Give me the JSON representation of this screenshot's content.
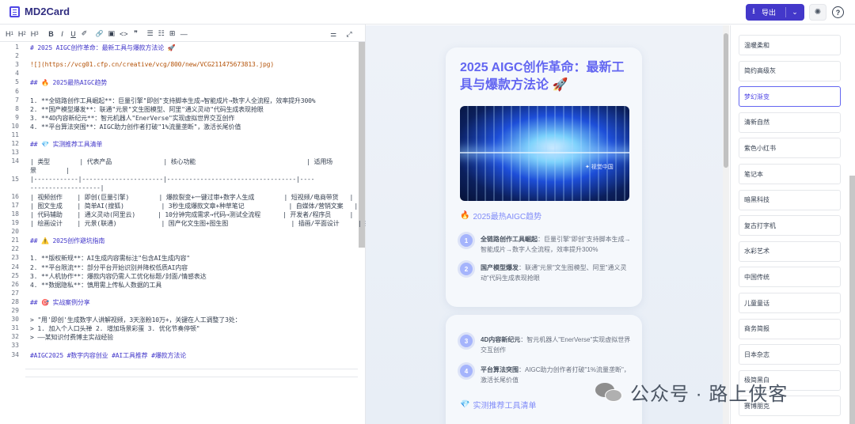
{
  "app": {
    "title": "MD2Card"
  },
  "header": {
    "export_label": "导出",
    "download_icon": "⭳",
    "chevron_icon": "⌄",
    "theme_icon": "✺",
    "help_icon": "?"
  },
  "toolbar": {
    "h1": "H",
    "h2": "H",
    "h3": "H",
    "s1": "1",
    "s2": "2",
    "s3": "3",
    "bold": "B",
    "italic": "I",
    "underline": "U",
    "strike": "✐",
    "link": "🔗",
    "image": "▣",
    "code": "<>",
    "quote": "❞",
    "ul": "☰",
    "ol": "☷",
    "table": "⊞",
    "hr": "—",
    "right1": "⚌",
    "right2": "⤢"
  },
  "editor": {
    "lines": [
      {
        "n": "1",
        "t": "# 2025 AIGC创作革命：最新工具与爆款方法论 🚀",
        "k": "hd"
      },
      {
        "n": "2",
        "t": "",
        "k": ""
      },
      {
        "n": "3",
        "t": "![](https://vcg01.cfp.cn/creative/vcg/800/new/VCG211475673813.jpg)",
        "k": "lnk"
      },
      {
        "n": "4",
        "t": "",
        "k": ""
      },
      {
        "n": "5",
        "t": "## 🔥 2025最热AIGC趋势",
        "k": "hd"
      },
      {
        "n": "6",
        "t": "",
        "k": ""
      },
      {
        "n": "7",
        "t": "1. **全链路创作工具崛起**：巨量引擎\"即创\"支持脚本生成→智能成片→数字人全流程，效率提升300%",
        "k": ""
      },
      {
        "n": "8",
        "t": "2. **国产模型爆发**：联通\"元景\"文生图模型、阿里\"通义灵动\"代码生成表现抢眼",
        "k": ""
      },
      {
        "n": "9",
        "t": "3. **4D内容新纪元**：智元机器人\"EnerVerse\"实现虚拟世界交互创作",
        "k": ""
      },
      {
        "n": "10",
        "t": "4. **平台算法突围**：AIGC助力创作者打破\"1%流量垄断\"，激活长尾价值",
        "k": ""
      },
      {
        "n": "11",
        "t": "",
        "k": ""
      },
      {
        "n": "12",
        "t": "## 💎 实测推荐工具清单",
        "k": "hd"
      },
      {
        "n": "13",
        "t": "",
        "k": ""
      },
      {
        "n": "14",
        "t": "| 类型        | 代表产品              | 核心功能                              | 适用场",
        "k": "tbl"
      },
      {
        "n": "",
        "t": "景        |",
        "k": "tbl"
      },
      {
        "n": "15",
        "t": "|------------|----------------------|-----------------------------------|----",
        "k": "tbl"
      },
      {
        "n": "",
        "t": "-------------------|",
        "k": "tbl"
      },
      {
        "n": "16",
        "t": "| 视频创作    | 即创(巨量引擎)        | 爆款裂变+一键过审+数字人生成        | 短视频/电商带货   |",
        "k": "tbl"
      },
      {
        "n": "17",
        "t": "| 图文生成    | 简单AI(搜狐)          | 3秒生成爆款文章+种草笔记            | 自媒体/营销文案   |",
        "k": "tbl"
      },
      {
        "n": "18",
        "t": "| 代码辅助    | 通义灵动(阿里云)      | 10分钟完成需求→代码→测试全流程      | 开发者/程序员     |",
        "k": "tbl"
      },
      {
        "n": "19",
        "t": "| 绘画设计    | 元景(联通)            | 国产化文生图+图生图                 | 插画/平面设计     |",
        "k": "tbl"
      },
      {
        "n": "20",
        "t": "",
        "k": ""
      },
      {
        "n": "21",
        "t": "## ⚠️ 2025创作避坑指南",
        "k": "hd"
      },
      {
        "n": "22",
        "t": "",
        "k": ""
      },
      {
        "n": "23",
        "t": "1. **版权新规**：AI生成内容需标注\"包含AI生成内容\"",
        "k": ""
      },
      {
        "n": "24",
        "t": "2. **平台限流**：部分平台开始识别并降权低质AI内容",
        "k": ""
      },
      {
        "n": "25",
        "t": "3. **人机协作**：爆款内容仍需人工优化标题/封面/情感表达",
        "k": ""
      },
      {
        "n": "26",
        "t": "4. **数据隐私**：慎用需上传私人数据的工具",
        "k": ""
      },
      {
        "n": "27",
        "t": "",
        "k": ""
      },
      {
        "n": "28",
        "t": "## 🎯 实战案例分享",
        "k": "hd"
      },
      {
        "n": "29",
        "t": "",
        "k": ""
      },
      {
        "n": "30",
        "t": "> \"用'即创'生成数字人讲解视频，3天涨粉10万+，关键在人工调整了3处：",
        "k": ""
      },
      {
        "n": "31",
        "t": "> 1. 加入个人口头禅 2. 增加场景彩蛋 3. 优化节奏停顿\"",
        "k": ""
      },
      {
        "n": "32",
        "t": "> ——某知识付费博主实战经验",
        "k": ""
      },
      {
        "n": "33",
        "t": "",
        "k": ""
      },
      {
        "n": "34",
        "t": "#AIGC2025 #数字内容创业 #AI工具推荐 #爆款方法论",
        "k": "tag"
      }
    ]
  },
  "preview": {
    "title": "2025 AIGC创作革命：最新工具与爆款方法论 🚀",
    "hero_mark": "✦ 视觉中国",
    "section1": "2025最热AIGC趋势",
    "section1_icon": "🔥",
    "items1": [
      {
        "num": "1",
        "bold": "全链路创作工具崛起",
        "text": "：巨量引擎\"即创\"支持脚本生成→智能成片→数字人全流程，效率提升300%"
      },
      {
        "num": "2",
        "bold": "国产模型爆发",
        "text": "：联通\"元景\"文生图模型、阿里\"通义灵动\"代码生成表现抢眼"
      }
    ],
    "items2": [
      {
        "num": "3",
        "bold": "4D内容新纪元",
        "text": "：智元机器人\"EnerVerse\"实现虚拟世界交互创作"
      },
      {
        "num": "4",
        "bold": "平台算法突围",
        "text": "：AIGC助力创作者打破\"1%流量垄断\"，激活长尾价值"
      }
    ],
    "section2": "实测推荐工具清单",
    "section2_icon": "💎"
  },
  "themes": {
    "items": [
      "温暖柔和",
      "简约高级灰",
      "梦幻渐变",
      "清新自然",
      "紫色小红书",
      "笔记本",
      "暗黑科技",
      "复古打字机",
      "水彩艺术",
      "中国传统",
      "儿童童话",
      "商务简报",
      "日本杂志",
      "极简黑白",
      "赛博朋克"
    ],
    "active": "梦幻渐变"
  },
  "watermark": {
    "text": "公众号 · 路上侠客"
  }
}
